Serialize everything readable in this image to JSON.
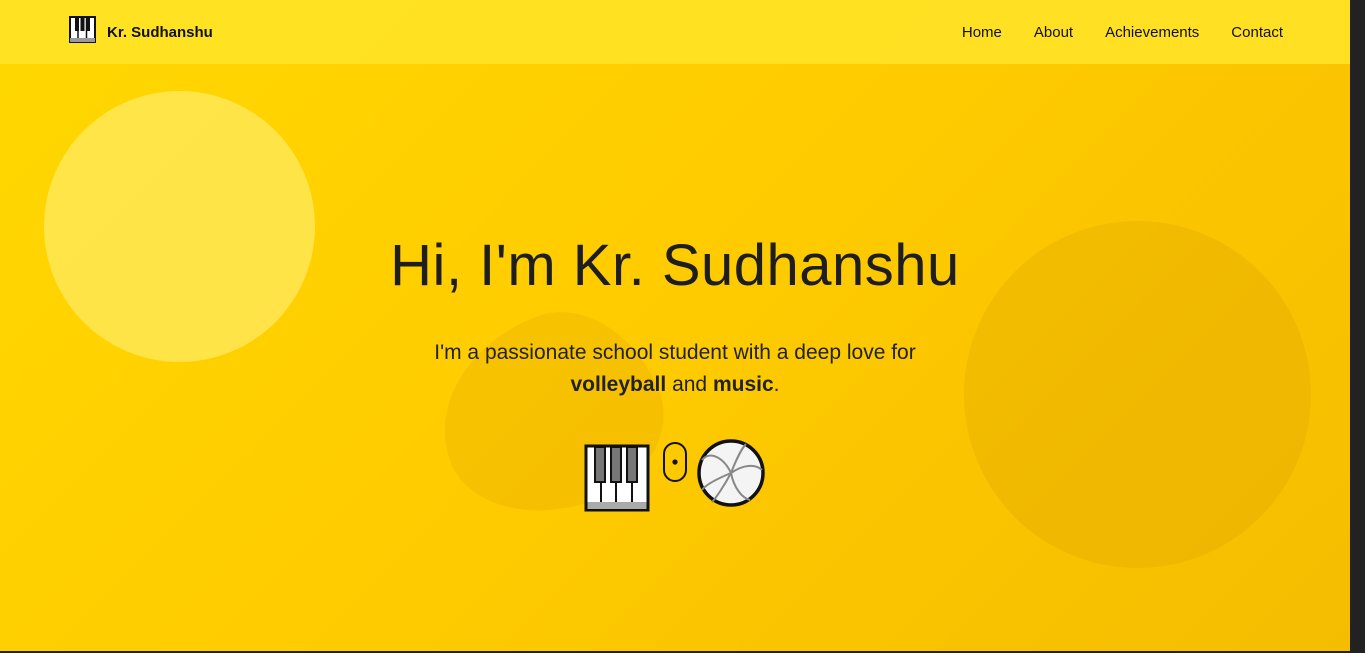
{
  "navbar": {
    "brand": "Kr. Sudhanshu",
    "links": [
      "Home",
      "About",
      "Achievements",
      "Contact"
    ]
  },
  "hero": {
    "title": "Hi, I'm Kr. Sudhanshu",
    "subtitle_start": "I'm a passionate school student with a deep love for",
    "highlight_1": "volleyball",
    "connector": "and",
    "highlight_2": "music",
    "end": "."
  },
  "icons": [
    "piano-icon",
    "mouse-scroll-icon",
    "volleyball-icon"
  ],
  "colors": {
    "background": "#ffcc00",
    "navbar": "#ffe428",
    "text": "#1e1e1e"
  }
}
